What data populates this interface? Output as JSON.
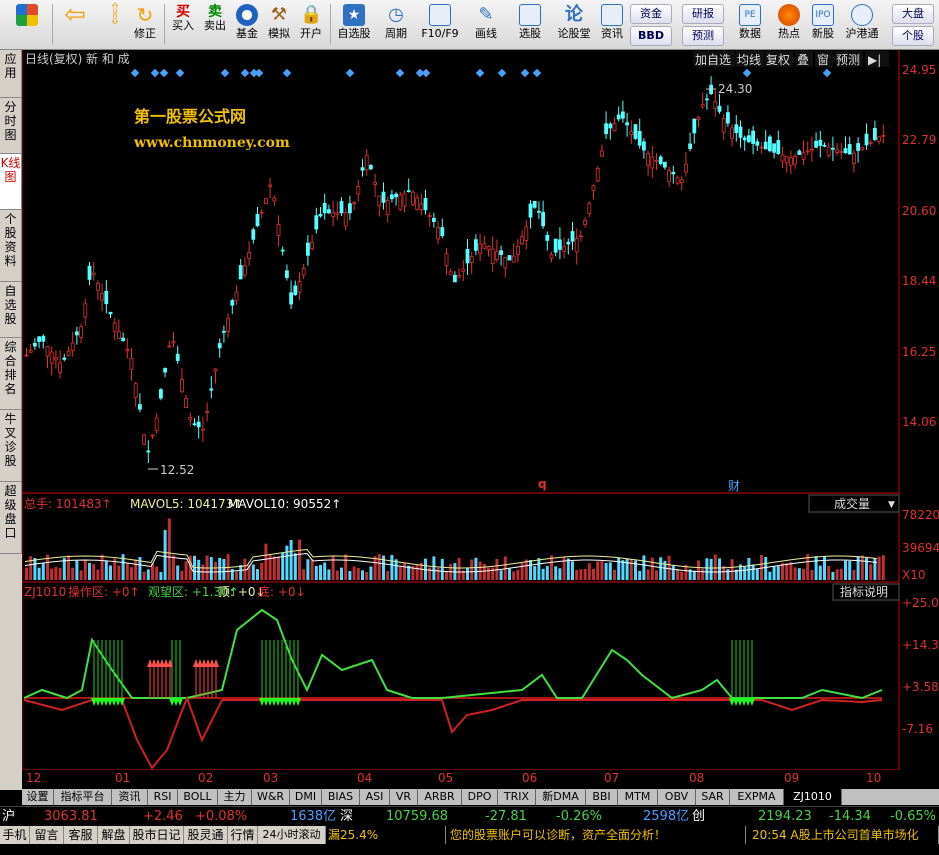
{
  "toolbar": {
    "buttons": [
      {
        "label": "",
        "icon": "app-logo-icon",
        "color": "#e04a2a"
      },
      {
        "label": "",
        "icon": "back-arrow-icon",
        "color": "#f0a000"
      },
      {
        "label": "",
        "icon": "up-down-icon",
        "color": "#f0a000"
      },
      {
        "label": "修正",
        "icon": "refresh-icon",
        "color": "#f0a000"
      },
      {
        "label": "买入",
        "icon": "buy-icon",
        "color": "#d00000"
      },
      {
        "label": "卖出",
        "icon": "sell-icon",
        "color": "#008000"
      },
      {
        "label": "基金",
        "icon": "fund-icon",
        "color": "#2060c0"
      },
      {
        "label": "模拟",
        "icon": "hammer-icon",
        "color": "#a06020"
      },
      {
        "label": "开户",
        "icon": "lock-icon",
        "color": "#a08040"
      },
      {
        "label": "自选股",
        "icon": "star-icon",
        "color": "#3070c0"
      },
      {
        "label": "周期",
        "icon": "clock-icon",
        "color": "#3070c0"
      },
      {
        "label": "F10/F9",
        "icon": "document-icon",
        "color": "#3070c0"
      },
      {
        "label": "画线",
        "icon": "pen-icon",
        "color": "#3070c0"
      },
      {
        "label": "选股",
        "icon": "screen-icon",
        "color": "#3070c0"
      },
      {
        "label": "论股堂",
        "icon": "forum-icon",
        "color": "#3070c0"
      },
      {
        "label": "资讯",
        "icon": "news-icon",
        "color": "#3070c0"
      },
      {
        "label": "数据",
        "icon": "pe-icon",
        "color": "#3070c0"
      },
      {
        "label": "热点",
        "icon": "hot-icon",
        "color": "#d04000"
      },
      {
        "label": "新股",
        "icon": "ipo-icon",
        "color": "#3070c0"
      },
      {
        "label": "沪港通",
        "icon": "hk-icon",
        "color": "#3070c0"
      }
    ],
    "small": [
      {
        "label": "资金"
      },
      {
        "label": "BBD"
      },
      {
        "label": "研报"
      },
      {
        "label": "预测"
      },
      {
        "label": "大盘"
      },
      {
        "label": "个股"
      }
    ]
  },
  "sidebar": [
    {
      "label": "应用"
    },
    {
      "label": "分时图"
    },
    {
      "label": "K线图"
    },
    {
      "label": "个股资料"
    },
    {
      "label": "自选股"
    },
    {
      "label": "综合排名"
    },
    {
      "label": "牛叉诊股"
    },
    {
      "label": "超级盘口"
    }
  ],
  "header": {
    "period": "日线(复权)",
    "stock": "新 和 成",
    "watermark1": "第一股票公式网",
    "watermark2": "www.chnmoney.com"
  },
  "header_buttons": [
    {
      "label": "加自选"
    },
    {
      "label": "均线"
    },
    {
      "label": "复权"
    },
    {
      "label": "叠"
    },
    {
      "label": "窗"
    },
    {
      "label": "预测"
    },
    {
      "label": "▶|"
    }
  ],
  "price_axis": {
    "labels": [
      "24.95",
      "22.79",
      "20.60",
      "18.44",
      "16.25",
      "14.06"
    ]
  },
  "annotations": {
    "high": "24.30",
    "low": "12.52",
    "q_marker": "q",
    "cai_marker": "财"
  },
  "volume": {
    "text1": "总手: 101483↑",
    "text2": "MAVOL5: 104173↑",
    "text3": "MAVOL10: 90552↑",
    "dropdown": "成交量",
    "axis": [
      "78220",
      "39694",
      "X10"
    ]
  },
  "indicator": {
    "name": "ZJ1010",
    "t1": "操作区: +0↑",
    "t2": "观望区: +1.30↑",
    "t3": "顶: +0↓",
    "t4": "底: +0↓",
    "btn": "指标说明",
    "axis": [
      "+25.08",
      "+14.33",
      "+3.58",
      "-7.16"
    ]
  },
  "months": [
    "12",
    "01",
    "02",
    "03",
    "04",
    "05",
    "06",
    "07",
    "08",
    "09",
    "10"
  ],
  "tabs": [
    {
      "label": "设置"
    },
    {
      "label": "指标平台"
    },
    {
      "label": "资讯"
    },
    {
      "label": "RSI"
    },
    {
      "label": "BOLL"
    },
    {
      "label": "主力"
    },
    {
      "label": "W&R"
    },
    {
      "label": "DMI"
    },
    {
      "label": "BIAS"
    },
    {
      "label": "ASI"
    },
    {
      "label": "VR"
    },
    {
      "label": "ARBR"
    },
    {
      "label": "DPO"
    },
    {
      "label": "TRIX"
    },
    {
      "label": "新DMA"
    },
    {
      "label": "BBI"
    },
    {
      "label": "MTM"
    },
    {
      "label": "OBV"
    },
    {
      "label": "SAR"
    },
    {
      "label": "EXPMA"
    },
    {
      "label": "ZJ1010"
    }
  ],
  "status1": {
    "sh_label": "沪",
    "sh_val": "3063.81",
    "sh_chg": "+2.46",
    "sh_pct": "+0.08%",
    "sh_amt": "1638亿",
    "sz_label": "深",
    "sz_val": "10759.68",
    "sz_chg": "-27.81",
    "sz_pct": "-0.26%",
    "sz_amt": "2598亿",
    "cy_label": "创",
    "cy_val": "2194.23",
    "cy_chg": "-14.34",
    "cy_pct": "-0.65%"
  },
  "status2": {
    "items": [
      "手机",
      "留言",
      "客服",
      "解盘",
      "股市日记",
      "股灵通",
      "行情",
      "24小时滚动"
    ],
    "ticker1": "漏25.4%",
    "ticker2": "您的股票账户可以诊断，资产全面分析！",
    "ticker3": "20:54 A股上市公司首单市场化"
  },
  "chart_data": {
    "type": "candlestick",
    "price_range": [
      12.52,
      24.3
    ],
    "note": "daily K-line with volume and ZJ1010 indicator"
  }
}
